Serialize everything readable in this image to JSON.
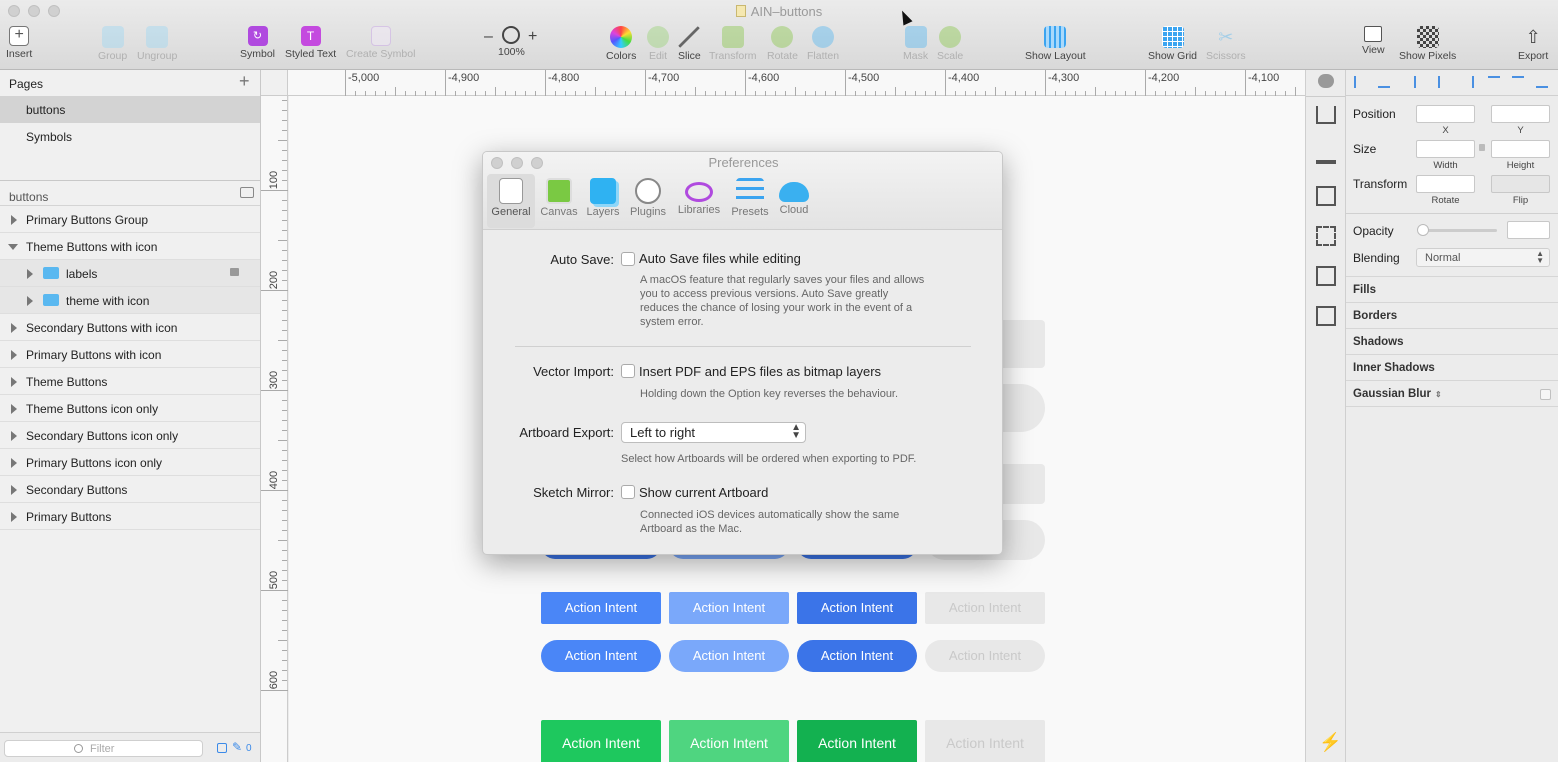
{
  "window": {
    "title": "AIN–buttons"
  },
  "toolbar": {
    "insert": "Insert",
    "group": "Group",
    "ungroup": "Ungroup",
    "symbol": "Symbol",
    "styled_text": "Styled Text",
    "create_symbol": "Create Symbol",
    "zoom_minus": "–",
    "zoom_plus": "+",
    "zoom": "100%",
    "colors": "Colors",
    "edit": "Edit",
    "slice": "Slice",
    "transform": "Transform",
    "rotate": "Rotate",
    "flatten": "Flatten",
    "mask": "Mask",
    "scale": "Scale",
    "show_layout": "Show Layout",
    "show_grid": "Show Grid",
    "scissors": "Scissors",
    "view": "View",
    "show_pixels": "Show Pixels",
    "export": "Export"
  },
  "sidebar": {
    "pages_title": "Pages",
    "add": "+",
    "pages": [
      {
        "label": "buttons"
      },
      {
        "label": "Symbols"
      }
    ],
    "layers_title": "buttons",
    "layers": [
      {
        "label": "Primary Buttons Group"
      },
      {
        "label": "Theme Buttons with icon"
      },
      {
        "label": "labels"
      },
      {
        "label": "theme with icon"
      },
      {
        "label": "Secondary Buttons with icon"
      },
      {
        "label": "Primary Buttons with icon"
      },
      {
        "label": "Theme Buttons"
      },
      {
        "label": "Theme Buttons icon only"
      },
      {
        "label": "Secondary Buttons icon only"
      },
      {
        "label": "Primary Buttons icon only"
      },
      {
        "label": "Secondary Buttons"
      },
      {
        "label": "Primary Buttons"
      }
    ],
    "filter_placeholder": "Filter",
    "filter_count": "0"
  },
  "rulers": {
    "top": [
      "-5,000",
      "-4,900",
      "-4,800",
      "-4,700",
      "-4,600",
      "-4,500",
      "-4,400",
      "-4,300",
      "-4,200",
      "-4,100"
    ],
    "left": [
      "100",
      "200",
      "300",
      "400",
      "500",
      "600"
    ]
  },
  "canvas": {
    "button_label": "Action Intent",
    "colors": {
      "blue": "#4a86f7",
      "blue_light": "#7aa8fa",
      "blue_dark": "#3b74e8",
      "disabled": "#e8e8e8",
      "green": "#1ec85e",
      "green_light": "#4fd580",
      "green_dark": "#13b150"
    }
  },
  "preferences": {
    "title": "Preferences",
    "tabs": [
      "General",
      "Canvas",
      "Layers",
      "Plugins",
      "Libraries",
      "Presets",
      "Cloud"
    ],
    "auto_save_label": "Auto Save:",
    "auto_save_option": "Auto Save files while editing",
    "auto_save_desc": "A macOS feature that regularly saves your files and allows you to access previous versions. Auto Save greatly reduces the chance of losing your work in the event of a system error.",
    "vector_import_label": "Vector Import:",
    "vector_import_option": "Insert PDF and EPS files as bitmap layers",
    "vector_import_desc": "Holding down the Option key reverses the behaviour.",
    "artboard_export_label": "Artboard Export:",
    "artboard_export_value": "Left to right",
    "artboard_export_desc": "Select how Artboards will be ordered when exporting to PDF.",
    "sketch_mirror_label": "Sketch Mirror:",
    "sketch_mirror_option": "Show current Artboard",
    "sketch_mirror_desc": "Connected iOS devices automatically show the same Artboard as the Mac."
  },
  "inspector": {
    "position": "Position",
    "x": "X",
    "y": "Y",
    "size": "Size",
    "width": "Width",
    "height": "Height",
    "transform": "Transform",
    "rotate": "Rotate",
    "flip": "Flip",
    "opacity": "Opacity",
    "blending": "Blending",
    "blending_value": "Normal",
    "sections": [
      "Fills",
      "Borders",
      "Shadows",
      "Inner Shadows",
      "Gaussian Blur"
    ]
  }
}
